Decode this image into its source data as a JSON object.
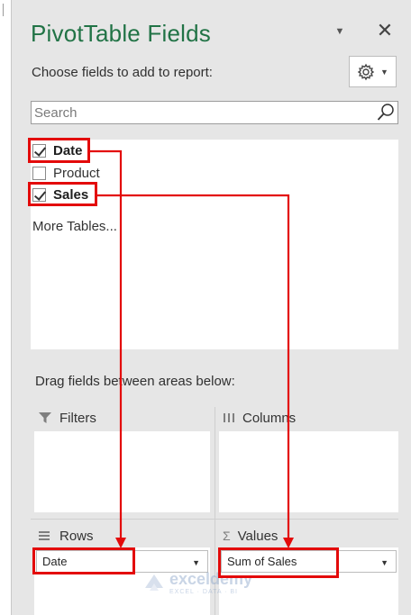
{
  "pane": {
    "title": "PivotTable Fields",
    "choose_label": "Choose fields to add to report:",
    "search_placeholder": "Search"
  },
  "fields": [
    {
      "label": "Date",
      "checked": true
    },
    {
      "label": "Product",
      "checked": false
    },
    {
      "label": "Sales",
      "checked": true
    }
  ],
  "more_tables": "More Tables...",
  "drag_label": "Drag fields between areas below:",
  "areas": {
    "filters": {
      "label": "Filters"
    },
    "columns": {
      "label": "Columns"
    },
    "rows": {
      "label": "Rows",
      "item": "Date"
    },
    "values": {
      "label": "Values",
      "item": "Sum of Sales"
    }
  },
  "watermark": {
    "name": "exceldemy",
    "tagline": "EXCEL · DATA · BI"
  },
  "colors": {
    "accent": "#217346",
    "highlight": "#e30a0a"
  },
  "icons": [
    "chevron-down-icon",
    "close-icon",
    "gear-icon",
    "search-icon",
    "filter-icon",
    "columns-icon",
    "rows-icon",
    "sigma-icon",
    "checkbox-icon"
  ]
}
